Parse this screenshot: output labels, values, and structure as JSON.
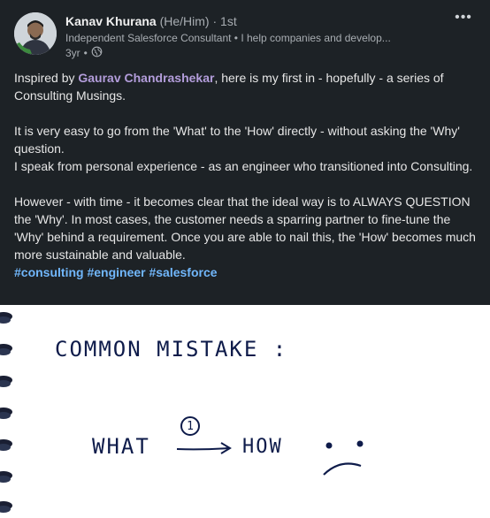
{
  "author": {
    "name": "Kanav Khurana",
    "pronouns": "(He/Him)",
    "degree": "1st",
    "headline": "Independent Salesforce Consultant • I help companies and develop...",
    "time": "3yr",
    "visibility_icon": "globe-icon"
  },
  "menu_icon": "more-icon",
  "post": {
    "intro_before": "Inspired by ",
    "mention": "Gaurav Chandrashekar",
    "intro_after": ", here is my first in - hopefully - a series of Consulting Musings.",
    "para2_line1": "It is very easy to go from the 'What' to the 'How' directly - without asking the 'Why' question.",
    "para2_line2": "I speak from personal experience - as an engineer who transitioned into Consulting.",
    "para3": "However - with time - it becomes clear that the ideal way is to ALWAYS QUESTION the 'Why'. In most cases, the customer needs a sparring partner to fine-tune the 'Why' behind a requirement. Once you are able to nail this, the 'How' becomes much more sustainable and valuable.",
    "hashtags": [
      "#consulting",
      "#engineer",
      "#salesforce"
    ]
  },
  "image": {
    "line1": "COMMON MISTAKE :",
    "what": "WHAT",
    "step": "1",
    "how": "HOW"
  }
}
